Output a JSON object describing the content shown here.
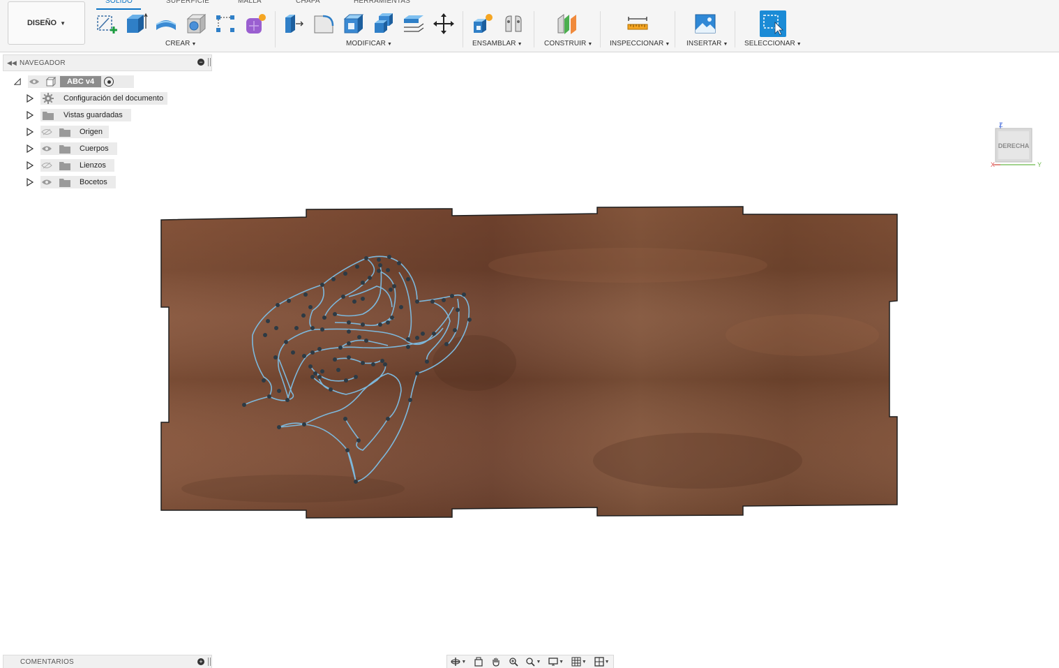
{
  "design_button": {
    "label": "DISEÑO"
  },
  "tabs": [
    {
      "label": "SÓLIDO",
      "active": true
    },
    {
      "label": "SUPERFICIE"
    },
    {
      "label": "MALLA"
    },
    {
      "label": "CHAPA"
    },
    {
      "label": "HERRAMIENTAS"
    }
  ],
  "groups": {
    "crear": "CREAR",
    "modificar": "MODIFICAR",
    "ensamblar": "ENSAMBLAR",
    "construir": "CONSTRUIR",
    "inspeccionar": "INSPECCIONAR",
    "insertar": "INSERTAR",
    "seleccionar": "SELECCIONAR"
  },
  "navigator": {
    "title": "NAVEGADOR",
    "root": "ABC v4",
    "items": [
      {
        "label": "Configuración del documento",
        "icon": "gear-icon"
      },
      {
        "label": "Vistas guardadas",
        "icon": "folder-icon"
      },
      {
        "label": "Origen",
        "icon": "folder-icon",
        "visible": false
      },
      {
        "label": "Cuerpos",
        "icon": "folder-icon",
        "visible": true
      },
      {
        "label": "Lienzos",
        "icon": "folder-icon",
        "visible": false
      },
      {
        "label": "Bocetos",
        "icon": "folder-icon",
        "visible": true
      }
    ]
  },
  "viewcube": {
    "face": "DERECHA",
    "axis_z": "Z",
    "axis_x": "X",
    "axis_y": "Y"
  },
  "comments": {
    "title": "COMENTARIOS"
  },
  "colors": {
    "accent": "#0a73c4",
    "wood": "#7b4a33",
    "sketch": "#6fa8cf"
  }
}
